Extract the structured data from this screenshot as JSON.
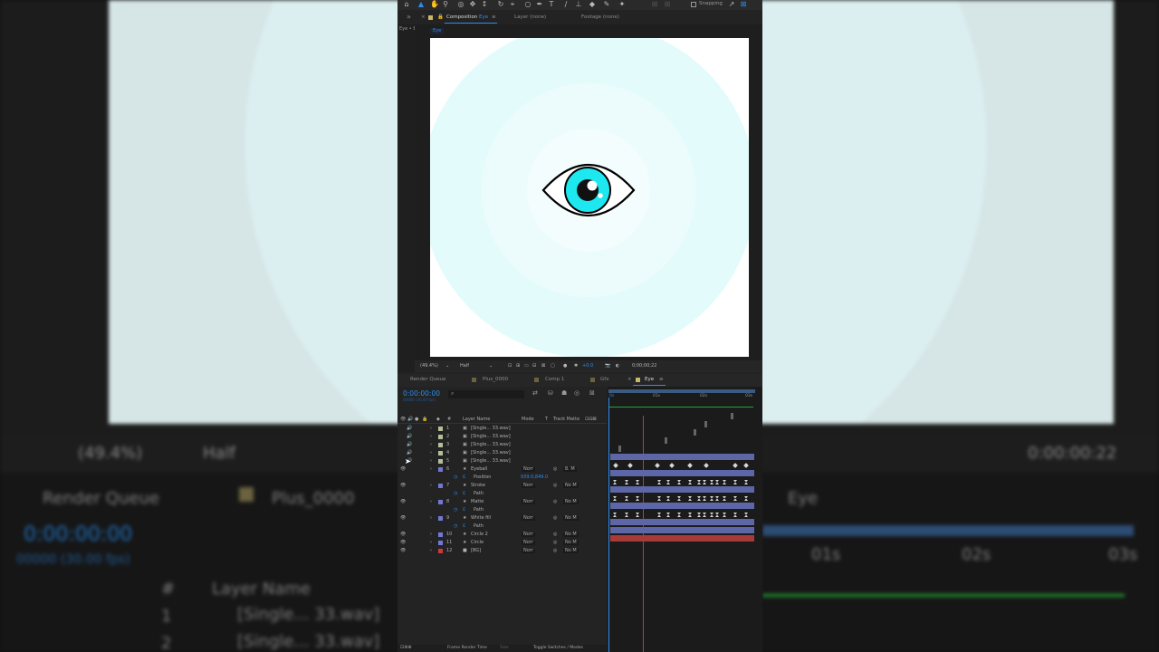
{
  "colors": {
    "accent": "#2d8ceb",
    "layer_label": "#7278d6",
    "audio_label": "#b4bf9a",
    "bg_label": "#cc3a3a",
    "cyan": "#1ee8ef"
  },
  "toolbar": {
    "snapping_label": "Snapping"
  },
  "viewer_tabs": {
    "composition_prefix": "Composition",
    "composition_name": "Eye",
    "layer": "Layer (none)",
    "footage": "Footage (none)"
  },
  "left_label": "Eye • E",
  "breadcrumb": "Eye",
  "viewer_bar": {
    "zoom": "(49.4%)",
    "resolution": "Half",
    "exposure": "+0.0",
    "timecode": "0;00;00;22"
  },
  "timeline_tabs": [
    "Render Queue",
    "Plus_0000",
    "Comp 1",
    "Gfx",
    "Eye"
  ],
  "timeline": {
    "current_time": "0:00:00:00",
    "fps_info": "00000 (30.00 fps)",
    "search_placeholder": "⌕"
  },
  "columns": {
    "num": "#",
    "layer_name": "Layer Name",
    "mode": "Mode",
    "t": "T",
    "track_matte": "Track Matte"
  },
  "ruler": {
    "start": "0s",
    "t1": "01s",
    "t2": "02s",
    "t3": "03s"
  },
  "layers": [
    {
      "num": "1",
      "name": "[Single... 33.wav]",
      "type": "audio"
    },
    {
      "num": "2",
      "name": "[Single... 33.wav]",
      "type": "audio"
    },
    {
      "num": "3",
      "name": "[Single... 33.wav]",
      "type": "audio"
    },
    {
      "num": "4",
      "name": "[Single... 33.wav]",
      "type": "audio"
    },
    {
      "num": "5",
      "name": "[Single... 33.wav]",
      "type": "audio"
    },
    {
      "num": "6",
      "name": "Eyeball",
      "type": "shape",
      "mode": "Norr",
      "matte": "8. M"
    },
    {
      "num": "",
      "name": "Position",
      "type": "prop",
      "value": "939.0,849.0"
    },
    {
      "num": "7",
      "name": "Stroke",
      "type": "shape",
      "mode": "Norr",
      "matte": "No M"
    },
    {
      "num": "",
      "name": "Path",
      "type": "prop"
    },
    {
      "num": "8",
      "name": "Matte",
      "type": "shape",
      "mode": "Norr",
      "matte": "No M"
    },
    {
      "num": "",
      "name": "Path",
      "type": "prop"
    },
    {
      "num": "9",
      "name": "White fill",
      "type": "shape",
      "mode": "Norr",
      "matte": "No M"
    },
    {
      "num": "",
      "name": "Path",
      "type": "prop"
    },
    {
      "num": "10",
      "name": "Circle 2",
      "type": "shape",
      "mode": "Norr",
      "matte": "No M"
    },
    {
      "num": "11",
      "name": "Circle",
      "type": "shape",
      "mode": "Norr",
      "matte": "No M"
    },
    {
      "num": "12",
      "name": "[BG]",
      "type": "solid",
      "mode": "Norr",
      "matte": "No M"
    }
  ],
  "footer": {
    "frame_render": "Frame Render Time",
    "frame_value": "1ms",
    "toggle": "Toggle Switches / Modes"
  },
  "bg": {
    "zoom": "(49.4%)",
    "res": "Half",
    "tc": "0:00:00:22",
    "render_queue": "Render Queue",
    "plus": "Plus_0000",
    "eye": "Eye",
    "time": "0:00:00:00",
    "fps": "00000 (30.00 fps)",
    "layer_name": "Layer Name",
    "hash": "#",
    "r1n": "1",
    "r1": "[Single... 33.wav]",
    "r2n": "2",
    "r2": "[Single... 33.wav]",
    "s1": "01s",
    "s2": "02s",
    "s3": "03s"
  }
}
